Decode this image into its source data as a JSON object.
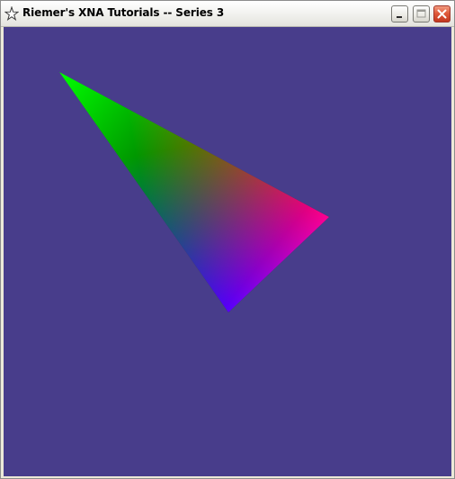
{
  "window": {
    "title": "Riemer's XNA Tutorials -- Series 3",
    "app_icon": "star-icon",
    "controls": [
      "minimize-icon",
      "maximize-icon",
      "close-icon"
    ]
  },
  "scene": {
    "background_color": "#483d8b",
    "triangle_vertex_colors": [
      "#00ff00",
      "#ff0000",
      "#0000ff"
    ]
  }
}
